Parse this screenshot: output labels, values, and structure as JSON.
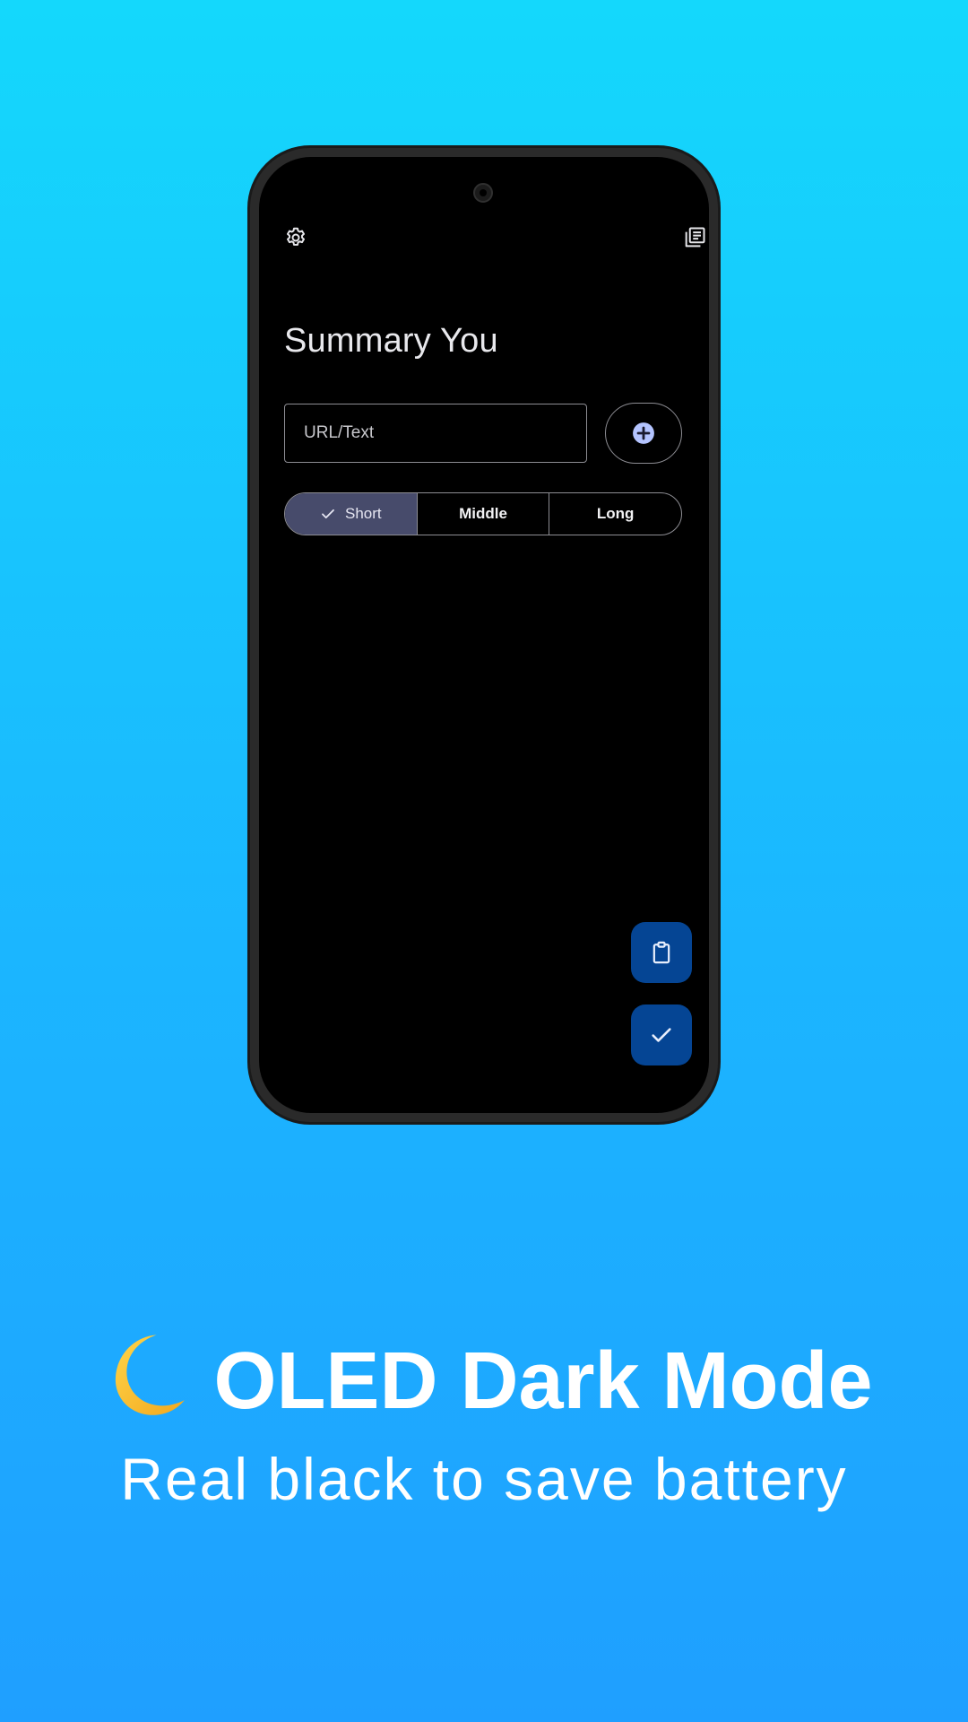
{
  "app": {
    "title": "Summary You"
  },
  "toolbar": {
    "settings_icon": "gear-icon",
    "history_icon": "library-books-icon"
  },
  "input": {
    "placeholder": "URL/Text",
    "value": "",
    "add_icon": "add-circle-icon"
  },
  "length_selector": {
    "options": [
      "Short",
      "Middle",
      "Long"
    ],
    "selected": "Short"
  },
  "fabs": {
    "paste_icon": "clipboard-icon",
    "submit_icon": "check-icon"
  },
  "promo": {
    "emoji_icon": "crescent-moon-icon",
    "headline": "OLED Dark Mode",
    "subhead": "Real black to save battery"
  },
  "colors": {
    "background_top": "#14d8fc",
    "background_bottom": "#1f9fff",
    "screen": "#000000",
    "selected_segment": "#474b6b",
    "fab": "#054594",
    "outline": "#8d8d93"
  }
}
